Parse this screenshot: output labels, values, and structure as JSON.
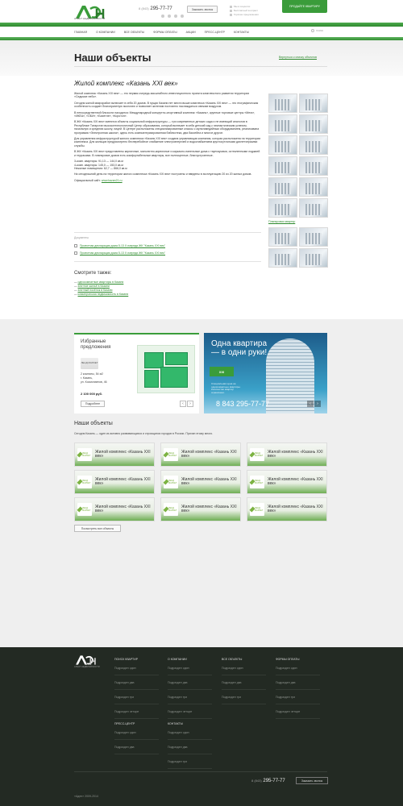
{
  "header": {
    "logo_text": "АГЕНТ НЕДВИЖИМОСТИ",
    "phone_prefix": "8 (843)",
    "phone": "295-77-77",
    "callback_label": "Заказать звонок",
    "mini_links": [
      "Мы в соцсетях",
      "Бесплатный контракт",
      "Горячие предложения"
    ],
    "sell_button": "ПРОДАЙТЕ КВАРТИРУ",
    "search_label": "поиск"
  },
  "nav": [
    "ГЛАВНАЯ",
    "О КОМПАНИИ",
    "ВСЕ ОБЪЕКТЫ",
    "ФОРМЫ ОПЛАТЫ",
    "АКЦИИ",
    "ПРЕСС-ЦЕНТР",
    "КОНТАКТЫ"
  ],
  "page": {
    "title": "Наши объекты",
    "back_link": "Вернуться к списку объектов",
    "subtitle": "Жилой комплекс «Казань XXI век»",
    "paragraphs": [
      "Жилой комплекс «Казань XXI век» — это первая очередь масштабного инвестиционного проекта комплексного развития территории «Седьмое небо».",
      "Сегодня жилой микрорайон включает в себя 20 домов. В пущах Казани нет места выше комплекса «Казань XXI век» — это географическая особенность создает благоприятную экологию и позволяет жителям постоянно наслаждаться свежим воздухом.",
      "В непосредственной близости находятся: Международный концертно-спортивный комплекс «Казань», крупные торговые центры «Мега», «ИКЕА», «ОБИ», «Бахетле», «Корстон».",
      "В ЖК «Казань XXI век» имеются объекты социальной инфраструктуры — три современных детских сада и не имеющий аналогов в Республике Татарстан высокотехнологичный Центр образования, который включает в себя детский сад с гимнастическим успехом, начальную и среднюю школу, лицей. В Центре расположены специализированные классы с мультимедийным оборудованием, реализована программа «Электронная школа», здесь есть компьютеризированная библиотека, два бассейна и многое другое.",
      "Для управления инфраструктурой жилого комплекса «Казань XXI век» создана управляющая компания, которая расположена на территории комплекса. Для жильцов предусмотрено бесперебойное снабжение электроэнергией и водоснабжением круглосуточными диспетчерскими службы.",
      "В ЖК «Казань XXI век» представлены кирпичные, монолитно-кирпичные и каркасно-панельные дома с таунхаусами, остекленными лоджией и террасами. В планировке домов есть комфортабельные квартиры, все полноценные, благоустроенные.",
      "3-комн. квартиры: 91,13 — 144,0 кв.м\n4-комн. квартиры: 145,0 — 153,0 кв.м\nНежилые помещения: 62,7 — 866,0 кв.м",
      "На сегодняшний день на территории жилого комплекса «Казань XXI век» построены и введены в эксплуатацию 20 из 20 жилых домов."
    ],
    "site_label": "Официальный сайт:",
    "site_link": "www.kazan21.ru",
    "plan_link": "Планировки квартир",
    "docs_label": "Документы",
    "docs": [
      "Проектная декларация дома 5-13 II очереди ЖК \"Казань XXI век\"",
      "Проектная декларация дома 5-13 II очереди ЖК \"Казань XXI век\""
    ],
    "see_also_title": "Смотрите также:",
    "see_also": [
      "однокомнатные квартиры в Казани",
      "элитное жильё в Казани",
      "элитный посёлок в Казани",
      "коммерческая недвижимость в Казани"
    ]
  },
  "favorites": {
    "title": "Избранные предложения",
    "logo": "ЛЕНД МАРКЕТ",
    "info": [
      "2 комнаты, 54 м2",
      "г. Казань,",
      "ул. Космонавтов, 46"
    ],
    "price": "2 100 000 руб.",
    "more_label": "Подробнее",
    "prev": "‹",
    "next": "›"
  },
  "promo": {
    "headline": "Одна квартира — в одни руки!",
    "badge": "XXI",
    "small": "Специальная цена на однокомнатные квартиры. Количество квартир ограничено.",
    "phone": "8 843 295-77-77",
    "prev": "‹",
    "next": "›"
  },
  "objects": {
    "title": "Наши объекты",
    "desc": "Сегодня Казань — один из активно развивающихся и строящихся городов в России. Причин этому много.",
    "card_logo": "ЛЕНД МАРКЕТ",
    "cards": [
      "Жилой комплекс «Казань XXI век»",
      "Жилой комплекс «Казань XXI век»",
      "Жилой комплекс «Казань XXI век»",
      "Жилой комплекс «Казань XXI век»",
      "Жилой комплекс «Казань XXI век»",
      "Жилой комплекс «Казань XXI век»",
      "Жилой комплекс «Казань XXI век»",
      "Жилой комплекс «Казань XXI век»",
      "Жилой комплекс «Казань XXI век»"
    ],
    "show_all": "Посмотреть все объекты"
  },
  "footer": {
    "logo_text": "АГЕНТ НЕДВИЖИМОСТИ",
    "columns": [
      {
        "h": "ПОИСК КВАРТИР",
        "items": [
          "Подраздел один",
          "Подраздел два",
          "Подраздел три",
          "Подраздел четыре"
        ]
      },
      {
        "h": "О КОМПАНИИ",
        "items": [
          "Подраздел один",
          "Подраздел два",
          "Подраздел три",
          "Подраздел четыре"
        ]
      },
      {
        "h": "ВСЕ ОБЪЕКТЫ",
        "items": [
          "Подраздел один",
          "Подраздел два",
          "Подраздел три"
        ]
      },
      {
        "h": "ФОРМЫ ОПЛАТЫ",
        "items": [
          "Подраздел один",
          "Подраздел два",
          "Подраздел три",
          "Подраздел четыре"
        ]
      },
      {
        "h": "ПРЕСС-ЦЕНТР",
        "items": [
          "Подраздел один",
          "Подраздел два"
        ]
      },
      {
        "h": "КОНТАКТЫ",
        "items": [
          "Подраздел один",
          "Подраздел два",
          "Подраздел три"
        ]
      }
    ],
    "phone_prefix": "8 (843)",
    "phone": "295-77-77",
    "callback_label": "Заказать звонок",
    "copyright": "«Аден» 2009-2014"
  },
  "colors": {
    "accent": "#3a9c3a",
    "footer_bg": "#232a23",
    "link": "#2e8b2e"
  }
}
